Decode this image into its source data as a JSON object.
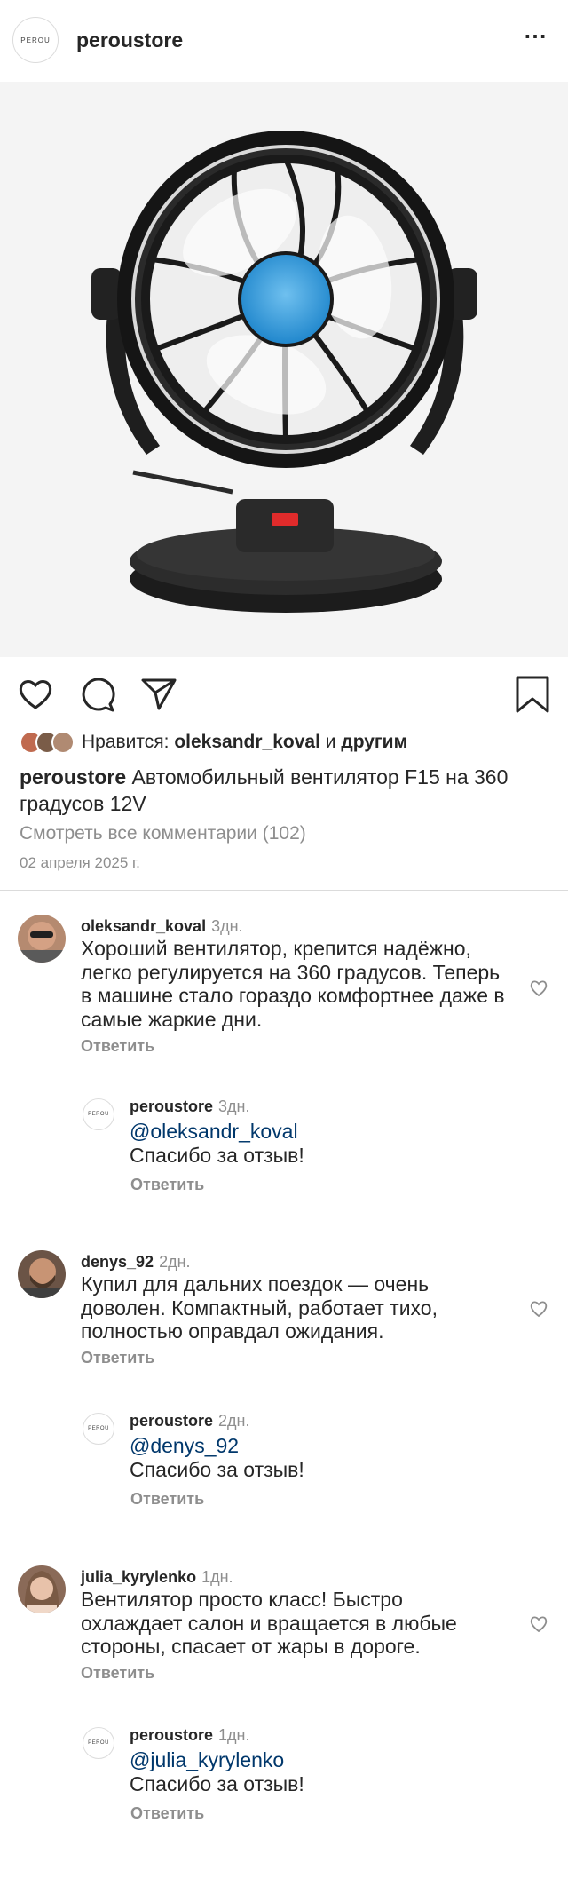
{
  "post": {
    "account": "peroustore",
    "logo_text": "PEROU",
    "more_icon": "⋯"
  },
  "likes": {
    "prefix": "Нравится:",
    "user": "oleksandr_koval",
    "joiner": "и",
    "suffix": "другим"
  },
  "caption": {
    "user": "peroustore",
    "text": "Автомобильный вентилятор F15 на 360 градусов 12V"
  },
  "view_all": "Смотреть все комментарии (102)",
  "date": "02 апреля 2025 г.",
  "reply_label": "Ответить",
  "comments": [
    {
      "user": "oleksandr_koval",
      "time": "3дн.",
      "text": "Хороший вентилятор, крепится надёжно, легко регулируется на 360 градусов. Теперь в машине стало гораздо комфортнее даже в самые жаркие дни.",
      "reply": {
        "user": "peroustore",
        "time": "3дн.",
        "mention": "@oleksandr_koval",
        "text": "Спасибо за отзыв!"
      }
    },
    {
      "user": "denys_92",
      "time": "2дн.",
      "text": "Купил для дальних поездок — очень доволен. Компактный, работает тихо, полностью оправдал ожидания.",
      "reply": {
        "user": "peroustore",
        "time": "2дн.",
        "mention": "@denys_92",
        "text": "Спасибо за отзыв!"
      }
    },
    {
      "user": "julia_kyrylenko",
      "time": "1дн.",
      "text": "Вентилятор просто класс! Быстро охлаждает салон и вращается в любые стороны, спасает от жары в дороге.",
      "reply": {
        "user": "peroustore",
        "time": "1дн.",
        "mention": "@julia_kyrylenko",
        "text": "Спасибо за отзыв!"
      }
    }
  ],
  "colors": {
    "link": "#00376b",
    "muted": "#8e8e8e",
    "fan_hub": "#2f9be0"
  },
  "icons": [
    "heart-icon",
    "comment-icon",
    "share-icon",
    "bookmark-icon",
    "more-icon"
  ]
}
